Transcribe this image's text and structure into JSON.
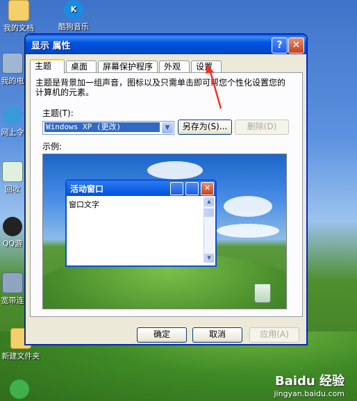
{
  "desktop": {
    "icons": [
      {
        "label": "我的文档"
      },
      {
        "label": "酷狗音乐"
      },
      {
        "label": "我的电"
      },
      {
        "label": "网上令"
      },
      {
        "label": "回收"
      },
      {
        "label": "QQ游"
      },
      {
        "label": "宽带连"
      },
      {
        "label": "新建文件夹"
      }
    ],
    "watermark_line1": "Baidu 经验",
    "watermark_line2": "jingyan.baidu.com"
  },
  "window": {
    "title": "显示 属性",
    "help_label": "?",
    "close_label": "✕",
    "tabs": [
      {
        "label": "主题"
      },
      {
        "label": "桌面"
      },
      {
        "label": "屏幕保护程序"
      },
      {
        "label": "外观"
      },
      {
        "label": "设置"
      }
    ],
    "description": "主题是背景加一组声音，图标以及只需单击即可帮您个性化设置您的计算机的元素。",
    "theme_label": "主题(T):",
    "theme_value": "Windows XP (更改)",
    "save_as_label": "另存为(S)...",
    "delete_label": "删除(D)",
    "preview_label": "示例:",
    "preview": {
      "window_title": "活动窗口",
      "window_text": "窗口文字"
    },
    "ok_label": "确定",
    "cancel_label": "取消",
    "apply_label": "应用(A)"
  },
  "colors": {
    "titlebar": "#0054e3",
    "dialog_bg": "#ece9d8",
    "selection": "#316ac5",
    "annotation_arrow": "#ee3322"
  }
}
